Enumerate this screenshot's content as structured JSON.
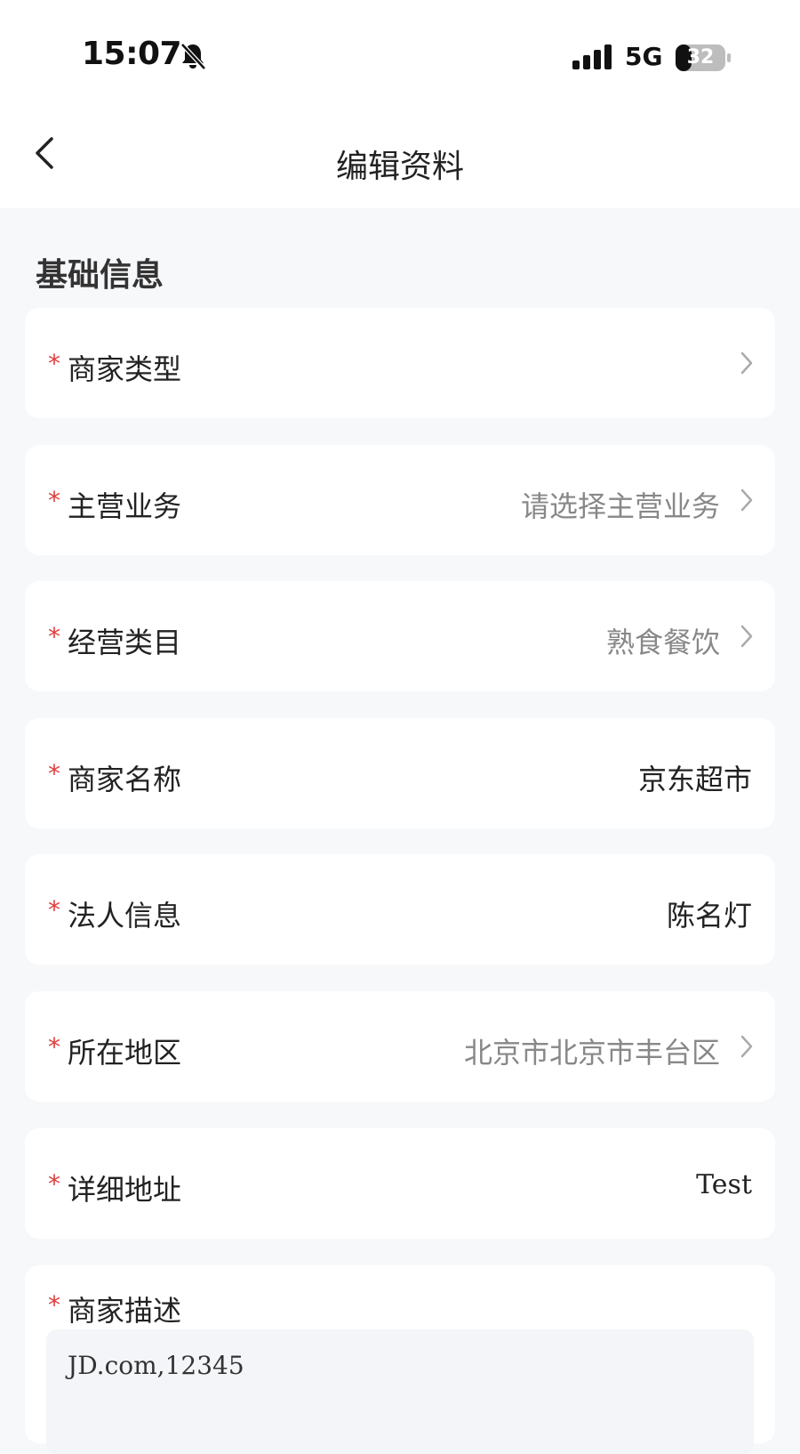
{
  "status_bar": {
    "time": "15:07",
    "network": "5G",
    "battery": "32"
  },
  "nav": {
    "title": "编辑资料"
  },
  "section": {
    "title": "基础信息"
  },
  "required_mark": "*",
  "rows": [
    {
      "label": "商家类型",
      "value": "",
      "has_chevron": true
    },
    {
      "label": "主营业务",
      "value": "请选择主营业务",
      "has_chevron": true
    },
    {
      "label": "经营类目",
      "value": "熟食餐饮",
      "has_chevron": true
    },
    {
      "label": "商家名称",
      "value": "京东超市",
      "has_chevron": false
    },
    {
      "label": "法人信息",
      "value": "陈名灯",
      "has_chevron": false
    },
    {
      "label": "所在地区",
      "value": "北京市北京市丰台区",
      "has_chevron": true
    },
    {
      "label": "详细地址",
      "value": "Test",
      "has_chevron": false
    }
  ],
  "description": {
    "label": "商家描述",
    "value": "JD.com,12345"
  },
  "colors": {
    "required": "#e03c3c",
    "background": "#f7f8fa",
    "placeholder": "#888888",
    "text": "#222222"
  }
}
